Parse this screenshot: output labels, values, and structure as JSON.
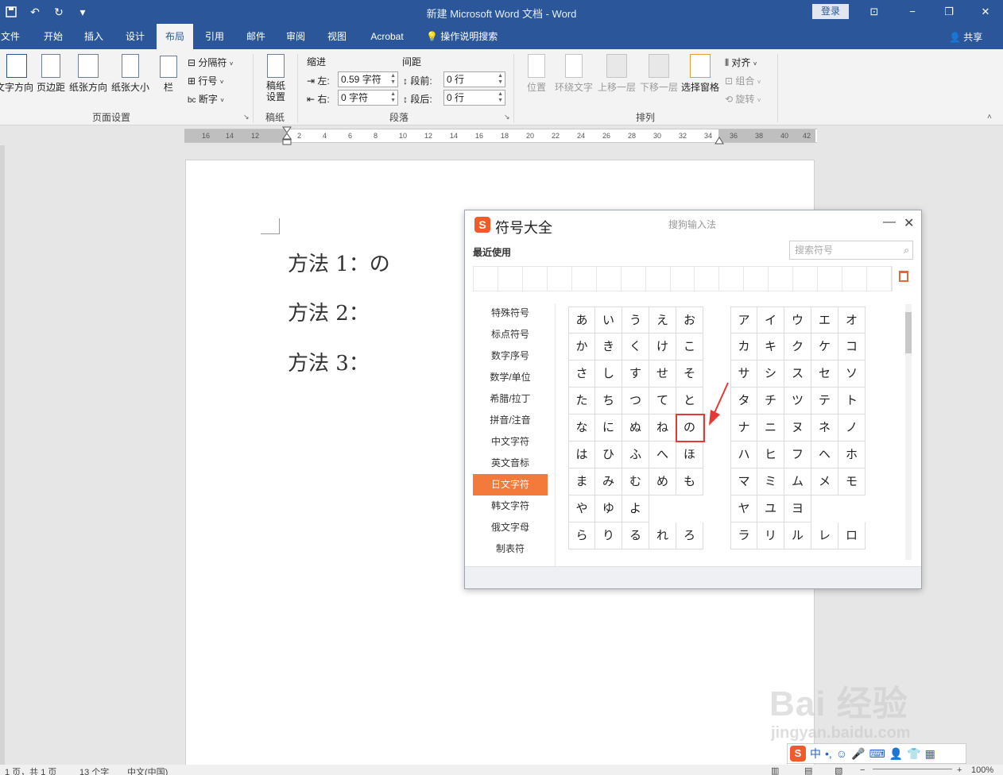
{
  "window": {
    "title": "新建 Microsoft Word 文档 - Word",
    "login": "登录",
    "controls": [
      "⊡",
      "−",
      "❐",
      "✕"
    ]
  },
  "quick_access": [
    "save-icon",
    "undo-icon",
    "redo-icon",
    "customize-icon"
  ],
  "tabs": [
    {
      "label": "文件"
    },
    {
      "label": "开始"
    },
    {
      "label": "插入"
    },
    {
      "label": "设计"
    },
    {
      "label": "布局"
    },
    {
      "label": "引用"
    },
    {
      "label": "邮件"
    },
    {
      "label": "审阅"
    },
    {
      "label": "视图"
    },
    {
      "label": "Acrobat"
    },
    {
      "label": "操作说明搜索"
    }
  ],
  "share": "共享",
  "ribbon": {
    "page_setup": {
      "text_direction": "文字方向",
      "margins": "页边距",
      "orientation": "纸张方向",
      "size": "纸张大小",
      "columns": "栏",
      "breaks": "分隔符",
      "line_numbers": "行号",
      "hyphenation": "断字",
      "label": "页面设置"
    },
    "draft": {
      "settings": "稿纸\n设置",
      "label": "稿纸"
    },
    "paragraph": {
      "indent_header": "缩进",
      "spacing_header": "间距",
      "left_label": "左:",
      "left_value": "0.59 字符",
      "right_label": "右:",
      "right_value": "0 字符",
      "before_label": "段前:",
      "before_value": "0 行",
      "after_label": "段后:",
      "after_value": "0 行",
      "label": "段落"
    },
    "arrange": {
      "position": "位置",
      "wrap_text": "环绕文字",
      "bring_forward": "上移一层",
      "send_backward": "下移一层",
      "selection_pane": "选择窗格",
      "align": "对齐",
      "group": "组合",
      "rotate": "旋转",
      "label": "排列"
    }
  },
  "ruler_ticks": [
    "16",
    "14",
    "12",
    "2",
    "4",
    "6",
    "8",
    "10",
    "12",
    "14",
    "16",
    "18",
    "20",
    "22",
    "24",
    "26",
    "28",
    "30",
    "32",
    "34",
    "36",
    "38",
    "40",
    "42"
  ],
  "document": {
    "lines": [
      "方法 1：の",
      "方法 2：",
      "方法 3："
    ]
  },
  "symbol_dialog": {
    "title": "符号大全",
    "subtitle": "搜狗输入法",
    "recent_label": "最近使用",
    "search_placeholder": "搜索符号",
    "categories": [
      {
        "label": "特殊符号"
      },
      {
        "label": "标点符号"
      },
      {
        "label": "数字序号"
      },
      {
        "label": "数学/单位"
      },
      {
        "label": "希腊/拉丁"
      },
      {
        "label": "拼音/注音"
      },
      {
        "label": "中文字符"
      },
      {
        "label": "英文音标"
      },
      {
        "label": "日文字符",
        "active": true
      },
      {
        "label": "韩文字符"
      },
      {
        "label": "俄文字母"
      },
      {
        "label": "制表符"
      }
    ],
    "hiragana": [
      [
        "あ",
        "い",
        "う",
        "え",
        "お"
      ],
      [
        "か",
        "き",
        "く",
        "け",
        "こ"
      ],
      [
        "さ",
        "し",
        "す",
        "せ",
        "そ"
      ],
      [
        "た",
        "ち",
        "つ",
        "て",
        "と"
      ],
      [
        "な",
        "に",
        "ぬ",
        "ね",
        "の"
      ],
      [
        "は",
        "ひ",
        "ふ",
        "へ",
        "ほ"
      ],
      [
        "ま",
        "み",
        "む",
        "め",
        "も"
      ],
      [
        "や",
        "ゆ",
        "よ",
        "",
        ""
      ],
      [
        "ら",
        "り",
        "る",
        "れ",
        "ろ"
      ]
    ],
    "katakana": [
      [
        "ア",
        "イ",
        "ウ",
        "エ",
        "オ"
      ],
      [
        "カ",
        "キ",
        "ク",
        "ケ",
        "コ"
      ],
      [
        "サ",
        "シ",
        "ス",
        "セ",
        "ソ"
      ],
      [
        "タ",
        "チ",
        "ツ",
        "テ",
        "ト"
      ],
      [
        "ナ",
        "ニ",
        "ヌ",
        "ネ",
        "ノ"
      ],
      [
        "ハ",
        "ヒ",
        "フ",
        "ヘ",
        "ホ"
      ],
      [
        "マ",
        "ミ",
        "ム",
        "メ",
        "モ"
      ],
      [
        "ヤ",
        "ユ",
        "ヨ",
        "",
        ""
      ],
      [
        "ラ",
        "リ",
        "ル",
        "レ",
        "ロ"
      ]
    ],
    "highlighted_char": "の"
  },
  "status_bar": {
    "page": "1 页，共 1 页",
    "words": "13 个字",
    "language": "中文(中国)",
    "zoom": "100%"
  },
  "watermark": {
    "brand": "Bai 经验",
    "url": "jingyan.baidu.com"
  },
  "ime_bar": {
    "mode": "中",
    "punct": "•,"
  },
  "colors": {
    "word_blue": "#2b579a",
    "sogou_orange": "#f47a3b",
    "highlight_red": "#e53935"
  }
}
